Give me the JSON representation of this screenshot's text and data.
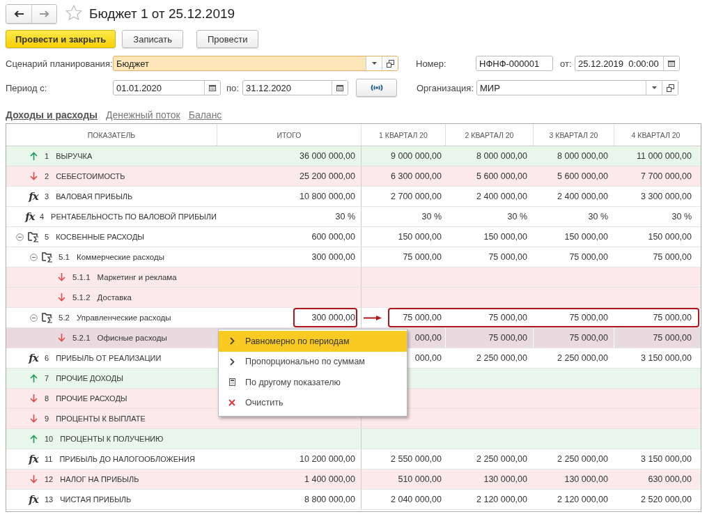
{
  "window": {
    "title": "Бюджет 1 от 25.12.2019",
    "favorite": false
  },
  "toolbar": {
    "buttons": [
      {
        "label": "Провести и закрыть",
        "kind": "primary"
      },
      {
        "label": "Записать",
        "kind": "normal"
      },
      {
        "label": "Провести",
        "kind": "normal"
      }
    ]
  },
  "form": {
    "scenario": {
      "label": "Сценарий планирования:",
      "value": "Бюджет",
      "focused": true
    },
    "number": {
      "label": "Номер:",
      "value": "НФНФ-000001"
    },
    "date": {
      "label": "от:",
      "value": "25.12.2019  0:00:00"
    },
    "period": {
      "label": "Период с:",
      "from": "01.01.2020",
      "to_label": "по:",
      "to": "31.12.2020"
    },
    "organization": {
      "label": "Организация:",
      "value": "МИР"
    }
  },
  "tabs": [
    {
      "label": "Доходы и расходы",
      "selected": true
    },
    {
      "label": "Денежный поток",
      "selected": false
    },
    {
      "label": "Баланс",
      "selected": false
    }
  ],
  "table": {
    "columns": [
      "ПОКАЗАТЕЛЬ",
      "ИТОГО",
      "1 КВАРТАЛ 20",
      "2 КВАРТАЛ 20",
      "3 КВАРТАЛ 20",
      "4 КВАРТАЛ 20"
    ],
    "rows": [
      {
        "number": "1",
        "name": "ВЫРУЧКА",
        "kind": "income",
        "selected": false,
        "total": "36 000 000,00",
        "quarters": [
          "9 000 000,00",
          "8 000 000,00",
          "8 000 000,00",
          "11 000 000,00"
        ]
      },
      {
        "number": "2",
        "name": "СЕБЕСТОИМОСТЬ",
        "kind": "expense",
        "selected": false,
        "total": "25 200 000,00",
        "quarters": [
          "6 300 000,00",
          "5 600 000,00",
          "5 600 000,00",
          "7 700 000,00"
        ]
      },
      {
        "number": "3",
        "name": "ВАЛОВАЯ ПРИБЫЛЬ",
        "kind": "formula",
        "icon": "fx",
        "selected": false,
        "total": "10 800 000,00",
        "quarters": [
          "2 700 000,00",
          "2 400 000,00",
          "2 400 000,00",
          "3 300 000,00"
        ]
      },
      {
        "number": "4",
        "name": "РЕНТАБЕЛЬНОСТЬ ПО ВАЛОВОЙ ПРИБЫЛИ",
        "kind": "formula",
        "icon": "fx",
        "selected": false,
        "total": "30 %",
        "quarters": [
          "30 %",
          "30 %",
          "30 %",
          "30 %"
        ]
      },
      {
        "number": "5",
        "name": "КОСВЕННЫЕ РАСХОДЫ",
        "kind": "group",
        "expanded": true,
        "selected": false,
        "total": "600 000,00",
        "quarters": [
          "150 000,00",
          "150 000,00",
          "150 000,00",
          "150 000,00"
        ],
        "children": [
          {
            "number": "5.1",
            "name": "Коммерческие расходы",
            "kind": "group",
            "expanded": true,
            "selected": false,
            "total": "300 000,00",
            "quarters": [
              "75 000,00",
              "75 000,00",
              "75 000,00",
              "75 000,00"
            ],
            "children": [
              {
                "number": "5.1.1",
                "name": "Маркетинг и реклама",
                "kind": "expense",
                "selected": false
              },
              {
                "number": "5.1.2",
                "name": "Доставка",
                "kind": "expense",
                "selected": false
              }
            ]
          },
          {
            "number": "5.2",
            "name": "Управленческие расходы",
            "kind": "group",
            "expanded": true,
            "selected": false,
            "callout": true,
            "total": "300 000,00",
            "quarters": [
              "75 000,00",
              "75 000,00",
              "75 000,00",
              "75 000,00"
            ],
            "children": [
              {
                "number": "5.2.1",
                "name": "Офисные расходы",
                "kind": "expense",
                "selected": true,
                "quarters": [
                  "000,00",
                  "75 000,00",
                  "75 000,00",
                  "75 000,00"
                ]
              }
            ]
          }
        ]
      },
      {
        "number": "6",
        "name": "ПРИБЫЛЬ ОТ РЕАЛИЗАЦИИ",
        "kind": "formula",
        "icon": "fx",
        "selected": false,
        "quarters": [
          "000,00",
          "2 250 000,00",
          "2 250 000,00",
          "3 150 000,00"
        ]
      },
      {
        "number": "7",
        "name": "ПРОЧИЕ ДОХОДЫ",
        "kind": "income",
        "selected": false
      },
      {
        "number": "8",
        "name": "ПРОЧИЕ РАСХОДЫ",
        "kind": "expense",
        "selected": false
      },
      {
        "number": "9",
        "name": "ПРОЦЕНТЫ К ВЫПЛАТЕ",
        "kind": "expense",
        "selected": false
      },
      {
        "number": "10",
        "name": "ПРОЦЕНТЫ К ПОЛУЧЕНИЮ",
        "kind": "income",
        "selected": false
      },
      {
        "number": "11",
        "name": "ПРИБЫЛЬ ДО НАЛОГООБЛОЖЕНИЯ",
        "kind": "formula",
        "icon": "fx",
        "selected": false,
        "total": "10 200 000,00",
        "quarters": [
          "2 550 000,00",
          "2 250 000,00",
          "2 250 000,00",
          "3 150 000,00"
        ]
      },
      {
        "number": "12",
        "name": "НАЛОГ НА ПРИБЫЛЬ",
        "kind": "expense",
        "selected": false,
        "total": "1 400 000,00",
        "quarters": [
          "510 000,00",
          "130 000,00",
          "130 000,00",
          "630 000,00"
        ]
      },
      {
        "number": "13",
        "name": "ЧИСТАЯ ПРИБЫЛЬ",
        "kind": "formula",
        "icon": "fx",
        "selected": false,
        "total": "8 800 000,00",
        "quarters": [
          "2 040 000,00",
          "2 120 000,00",
          "2 120 000,00",
          "2 520 000,00"
        ]
      }
    ]
  },
  "context_menu": {
    "items": [
      {
        "label": "Равномерно по периодам",
        "kind": "chevron",
        "selected": true
      },
      {
        "label": "Пропорционально по суммам",
        "kind": "chevron",
        "selected": false
      },
      {
        "label": "По другому показателю",
        "kind": "calculator",
        "selected": false
      },
      {
        "label": "Очистить",
        "kind": "clear",
        "selected": false
      }
    ]
  }
}
